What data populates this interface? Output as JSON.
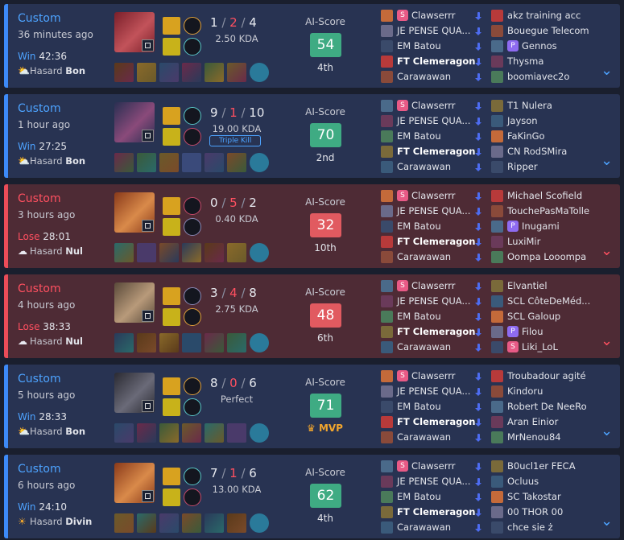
{
  "labels": {
    "ai_score": "AI-Score",
    "hasard": "Hasard"
  },
  "colors": {
    "win_accent": "#3d8af7",
    "lose_accent": "#ea4c58",
    "win_score": "#3fab83",
    "lose_score": "#e15a60",
    "mvp": "#f0a52e"
  },
  "matches": [
    {
      "mode": "Custom",
      "ago": "36 minutes ago",
      "result": "Win",
      "duration": "42:36",
      "weather_icon": "sun-cloud-icon",
      "weather_value": "Bon",
      "kills": "1",
      "deaths": "2",
      "assists": "4",
      "ratio": "2.50 KDA",
      "multikill": "",
      "score": "54",
      "placement": "4th",
      "mvp": "",
      "team1": [
        {
          "name": "Clawserrr",
          "tag": "S"
        },
        {
          "name": "JE PENSE QUA...",
          "tag": ""
        },
        {
          "name": "EM Batou",
          "tag": ""
        },
        {
          "name": "FT Clemeragon",
          "tag": "",
          "me": true
        },
        {
          "name": "Carawawan",
          "tag": ""
        }
      ],
      "team2": [
        {
          "name": "akz training acc",
          "tag": ""
        },
        {
          "name": "Bouegue Telecom",
          "tag": ""
        },
        {
          "name": "Gennos",
          "tag": "P"
        },
        {
          "name": "Thysma",
          "tag": ""
        },
        {
          "name": "boomiavec2o",
          "tag": ""
        }
      ]
    },
    {
      "mode": "Custom",
      "ago": "1 hour ago",
      "result": "Win",
      "duration": "27:25",
      "weather_icon": "sun-cloud-icon",
      "weather_value": "Bon",
      "kills": "9",
      "deaths": "1",
      "assists": "10",
      "ratio": "19.00 KDA",
      "multikill": "Triple Kill",
      "score": "70",
      "placement": "2nd",
      "mvp": "",
      "team1": [
        {
          "name": "Clawserrr",
          "tag": "S"
        },
        {
          "name": "JE PENSE QUA...",
          "tag": ""
        },
        {
          "name": "EM Batou",
          "tag": ""
        },
        {
          "name": "FT Clemeragon",
          "tag": "",
          "me": true
        },
        {
          "name": "Carawawan",
          "tag": ""
        }
      ],
      "team2": [
        {
          "name": "T1 Nulera",
          "tag": ""
        },
        {
          "name": "Jayson",
          "tag": ""
        },
        {
          "name": "FaKinGo",
          "tag": ""
        },
        {
          "name": "CN RodSMira",
          "tag": ""
        },
        {
          "name": "Ripper",
          "tag": ""
        }
      ]
    },
    {
      "mode": "Custom",
      "ago": "3 hours ago",
      "result": "Lose",
      "duration": "28:01",
      "weather_icon": "rain-cloud-icon",
      "weather_value": "Nul",
      "kills": "0",
      "deaths": "5",
      "assists": "2",
      "ratio": "0.40 KDA",
      "multikill": "",
      "score": "32",
      "placement": "10th",
      "mvp": "",
      "team1": [
        {
          "name": "Clawserrr",
          "tag": "S"
        },
        {
          "name": "JE PENSE QUA...",
          "tag": ""
        },
        {
          "name": "EM Batou",
          "tag": ""
        },
        {
          "name": "FT Clemeragon",
          "tag": "",
          "me": true
        },
        {
          "name": "Carawawan",
          "tag": ""
        }
      ],
      "team2": [
        {
          "name": "Michael Scofield",
          "tag": ""
        },
        {
          "name": "TouchePasMaTolle",
          "tag": ""
        },
        {
          "name": "Inugami",
          "tag": "P"
        },
        {
          "name": "LuxiMir",
          "tag": ""
        },
        {
          "name": "Oompa Looompa",
          "tag": ""
        }
      ]
    },
    {
      "mode": "Custom",
      "ago": "4 hours ago",
      "result": "Lose",
      "duration": "38:33",
      "weather_icon": "rain-cloud-icon",
      "weather_value": "Nul",
      "kills": "3",
      "deaths": "4",
      "assists": "8",
      "ratio": "2.75 KDA",
      "multikill": "",
      "score": "48",
      "placement": "6th",
      "mvp": "",
      "team1": [
        {
          "name": "Clawserrr",
          "tag": "S"
        },
        {
          "name": "JE PENSE QUA...",
          "tag": ""
        },
        {
          "name": "EM Batou",
          "tag": ""
        },
        {
          "name": "FT Clemeragon",
          "tag": "",
          "me": true
        },
        {
          "name": "Carawawan",
          "tag": ""
        }
      ],
      "team2": [
        {
          "name": "Elvantiel",
          "tag": ""
        },
        {
          "name": "SCL CôteDeMéd...",
          "tag": ""
        },
        {
          "name": "SCL Galoup",
          "tag": ""
        },
        {
          "name": "Filou",
          "tag": "P"
        },
        {
          "name": "Liki_LoL",
          "tag": "S"
        }
      ]
    },
    {
      "mode": "Custom",
      "ago": "5 hours ago",
      "result": "Win",
      "duration": "28:33",
      "weather_icon": "sun-cloud-icon",
      "weather_value": "Bon",
      "kills": "8",
      "deaths": "0",
      "assists": "6",
      "ratio": "Perfect",
      "multikill": "",
      "score": "71",
      "placement": "",
      "mvp": "MVP",
      "team1": [
        {
          "name": "Clawserrr",
          "tag": "S"
        },
        {
          "name": "JE PENSE QUA...",
          "tag": ""
        },
        {
          "name": "EM Batou",
          "tag": ""
        },
        {
          "name": "FT Clemeragon",
          "tag": "",
          "me": true
        },
        {
          "name": "Carawawan",
          "tag": ""
        }
      ],
      "team2": [
        {
          "name": "Troubadour agité",
          "tag": ""
        },
        {
          "name": "Kindoru",
          "tag": ""
        },
        {
          "name": "Robert De NeeRo",
          "tag": ""
        },
        {
          "name": "Aran Einior",
          "tag": ""
        },
        {
          "name": "MrNenou84",
          "tag": ""
        }
      ]
    },
    {
      "mode": "Custom",
      "ago": "6 hours ago",
      "result": "Win",
      "duration": "24:10",
      "weather_icon": "sun-icon",
      "weather_value": "Divin",
      "kills": "7",
      "deaths": "1",
      "assists": "6",
      "ratio": "13.00 KDA",
      "multikill": "",
      "score": "62",
      "placement": "4th",
      "mvp": "",
      "team1": [
        {
          "name": "Clawserrr",
          "tag": "S"
        },
        {
          "name": "JE PENSE QUA...",
          "tag": ""
        },
        {
          "name": "EM Batou",
          "tag": ""
        },
        {
          "name": "FT Clemeragon",
          "tag": "",
          "me": true
        },
        {
          "name": "Carawawan",
          "tag": ""
        }
      ],
      "team2": [
        {
          "name": "B0ucl1er FECA",
          "tag": ""
        },
        {
          "name": "Ocluus",
          "tag": ""
        },
        {
          "name": "SC Takostar",
          "tag": ""
        },
        {
          "name": "00 THOR 00",
          "tag": ""
        },
        {
          "name": "chce sie ż",
          "tag": ""
        }
      ]
    }
  ]
}
